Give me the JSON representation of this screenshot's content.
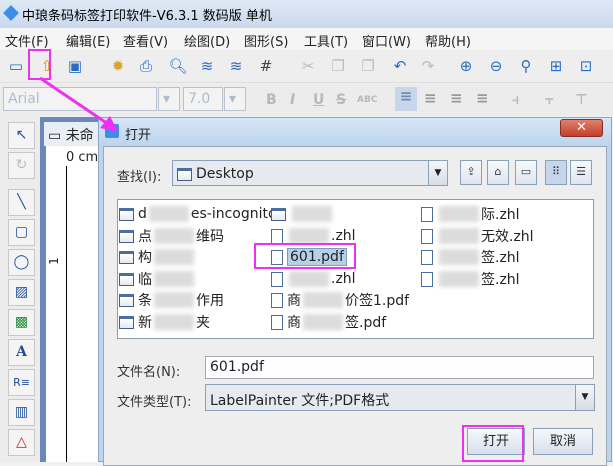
{
  "app": {
    "title": "中琅条码标签打印软件-V6.3.1 数码版 单机"
  },
  "menu": [
    "文件(F)",
    "编辑(E)",
    "查看(V)",
    "绘图(D)",
    "图形(S)",
    "工具(T)",
    "窗口(W)",
    "帮助(H)"
  ],
  "toolbar": {
    "icons": [
      "new-icon",
      "open-icon",
      "save-icon",
      "settings-icon",
      "print-icon",
      "print-preview-icon",
      "database-icon",
      "database-settings-icon",
      "grid-icon",
      "cut-icon",
      "copy-icon",
      "paste-icon",
      "undo-icon",
      "redo-icon",
      "zoom-in-icon",
      "zoom-out-icon",
      "zoom-icon",
      "fit-page-icon",
      "fit-width-icon"
    ]
  },
  "format": {
    "font": "Arial",
    "size": "7.0",
    "buttons": [
      "B",
      "I",
      "U",
      "S",
      "ABC"
    ]
  },
  "document": {
    "tab": "未命",
    "ruler_unit": "0 cm",
    "ruler_mark": "1"
  },
  "dialog": {
    "title": "打开",
    "look_in_label": "查找(I):",
    "look_in_value": "Desktop",
    "files": [
      {
        "pre": "d",
        "post": "es-incognito",
        "type": "folder"
      },
      {
        "pre": "点",
        "post": "维码",
        "type": "folder"
      },
      {
        "pre": "构",
        "post": "",
        "type": "folder"
      },
      {
        "pre": "临",
        "post": "",
        "type": "folder"
      },
      {
        "pre": "条",
        "post": "作用",
        "type": "folder"
      },
      {
        "pre": "新",
        "post": "夹",
        "type": "folder"
      },
      {
        "pre": "",
        "post": "",
        "type": "folder"
      },
      {
        "pre": "",
        "post": ".zhl",
        "type": "file"
      },
      {
        "pre": "601.pdf",
        "post": "",
        "type": "file",
        "selected": true
      },
      {
        "pre": "",
        "post": ".zhl",
        "type": "file"
      },
      {
        "pre": "商",
        "post": "价签1.pdf",
        "type": "file"
      },
      {
        "pre": "商",
        "post": "签.pdf",
        "type": "file"
      },
      {
        "pre": "",
        "post": "际.zhl",
        "type": "file"
      },
      {
        "pre": "",
        "post": "无效.zhl",
        "type": "file"
      },
      {
        "pre": "",
        "post": "签.zhl",
        "type": "file"
      },
      {
        "pre": "",
        "post": "签.zhl",
        "type": "file"
      }
    ],
    "filename_label": "文件名(N):",
    "filename_value": "601.pdf",
    "filetype_label": "文件类型(T):",
    "filetype_value": "LabelPainter 文件;PDF格式",
    "open_button": "打开",
    "cancel_button": "取消"
  },
  "colors": {
    "highlight": "#f030f0",
    "accent": "#2a6cc0"
  }
}
